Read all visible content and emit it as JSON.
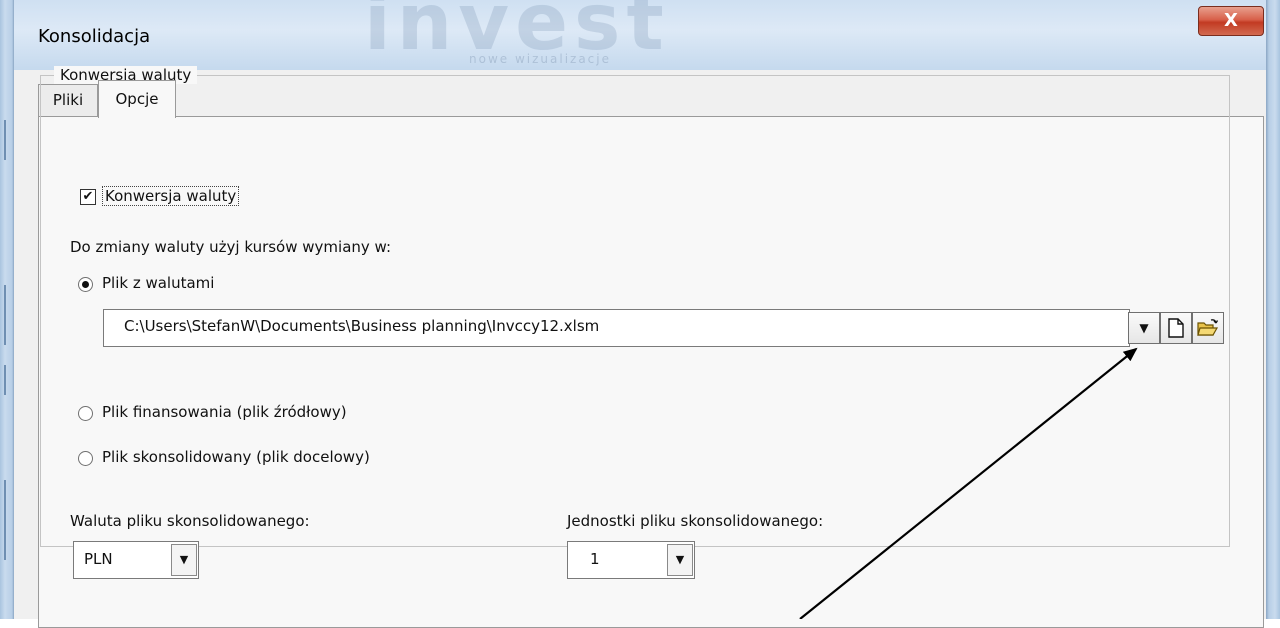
{
  "window": {
    "title": "Konsolidacja",
    "watermark": "invest",
    "watermark_sub": "nowe wizualizacje",
    "close_symbol": "X"
  },
  "tabs": [
    {
      "label": "Pliki",
      "active": false
    },
    {
      "label": "Opcje",
      "active": true
    }
  ],
  "group": {
    "legend": "Konwersja waluty",
    "checkbox": {
      "label": "Konwersja waluty",
      "checked": true
    },
    "rates_label": "Do zmiany waluty użyj kursów wymiany w:",
    "radios": [
      {
        "label": "Plik z walutami",
        "checked": true
      },
      {
        "label": "Plik finansowania (plik źródłowy)",
        "checked": false
      },
      {
        "label": "Plik skonsolidowany (plik docelowy)",
        "checked": false
      }
    ],
    "file_path": "C:\\Users\\StefanW\\Documents\\Business planning\\Invccy12.xlsm",
    "icons": {
      "dropdown": "dropdown-arrow-icon",
      "new_file": "new-file-icon",
      "open_folder": "open-folder-icon"
    },
    "currency_label": "Waluta pliku skonsolidowanego:",
    "currency_value": "PLN",
    "units_label": "Jednostki pliku skonsolidowanego:",
    "units_value": "1"
  }
}
